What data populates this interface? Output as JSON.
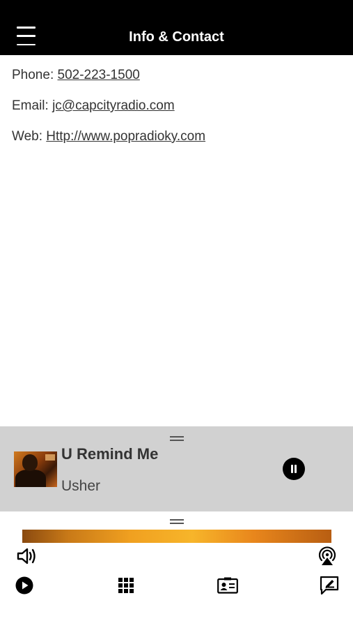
{
  "header": {
    "menu_icon": "hamburger-icon",
    "title": "Info & Contact"
  },
  "contact": {
    "phone_label": "Phone: ",
    "phone_value": "502-223-1500",
    "email_label": "Email: ",
    "email_value": "jc@capcityradio.com",
    "web_label": "Web: ",
    "web_value": "Http://www.popradioky.com"
  },
  "now_playing": {
    "title": "U Remind Me",
    "artist": "Usher",
    "state_icon": "pause-icon",
    "background": "#d1d1d1"
  },
  "player_controls": {
    "icons": [
      "volume-icon",
      "airplay-icon",
      "play-icon",
      "grid-icon",
      "contact-card-icon",
      "compose-icon"
    ]
  },
  "colors": {
    "header_bg": "#000000",
    "header_text": "#ffffff",
    "text": "#333333"
  }
}
